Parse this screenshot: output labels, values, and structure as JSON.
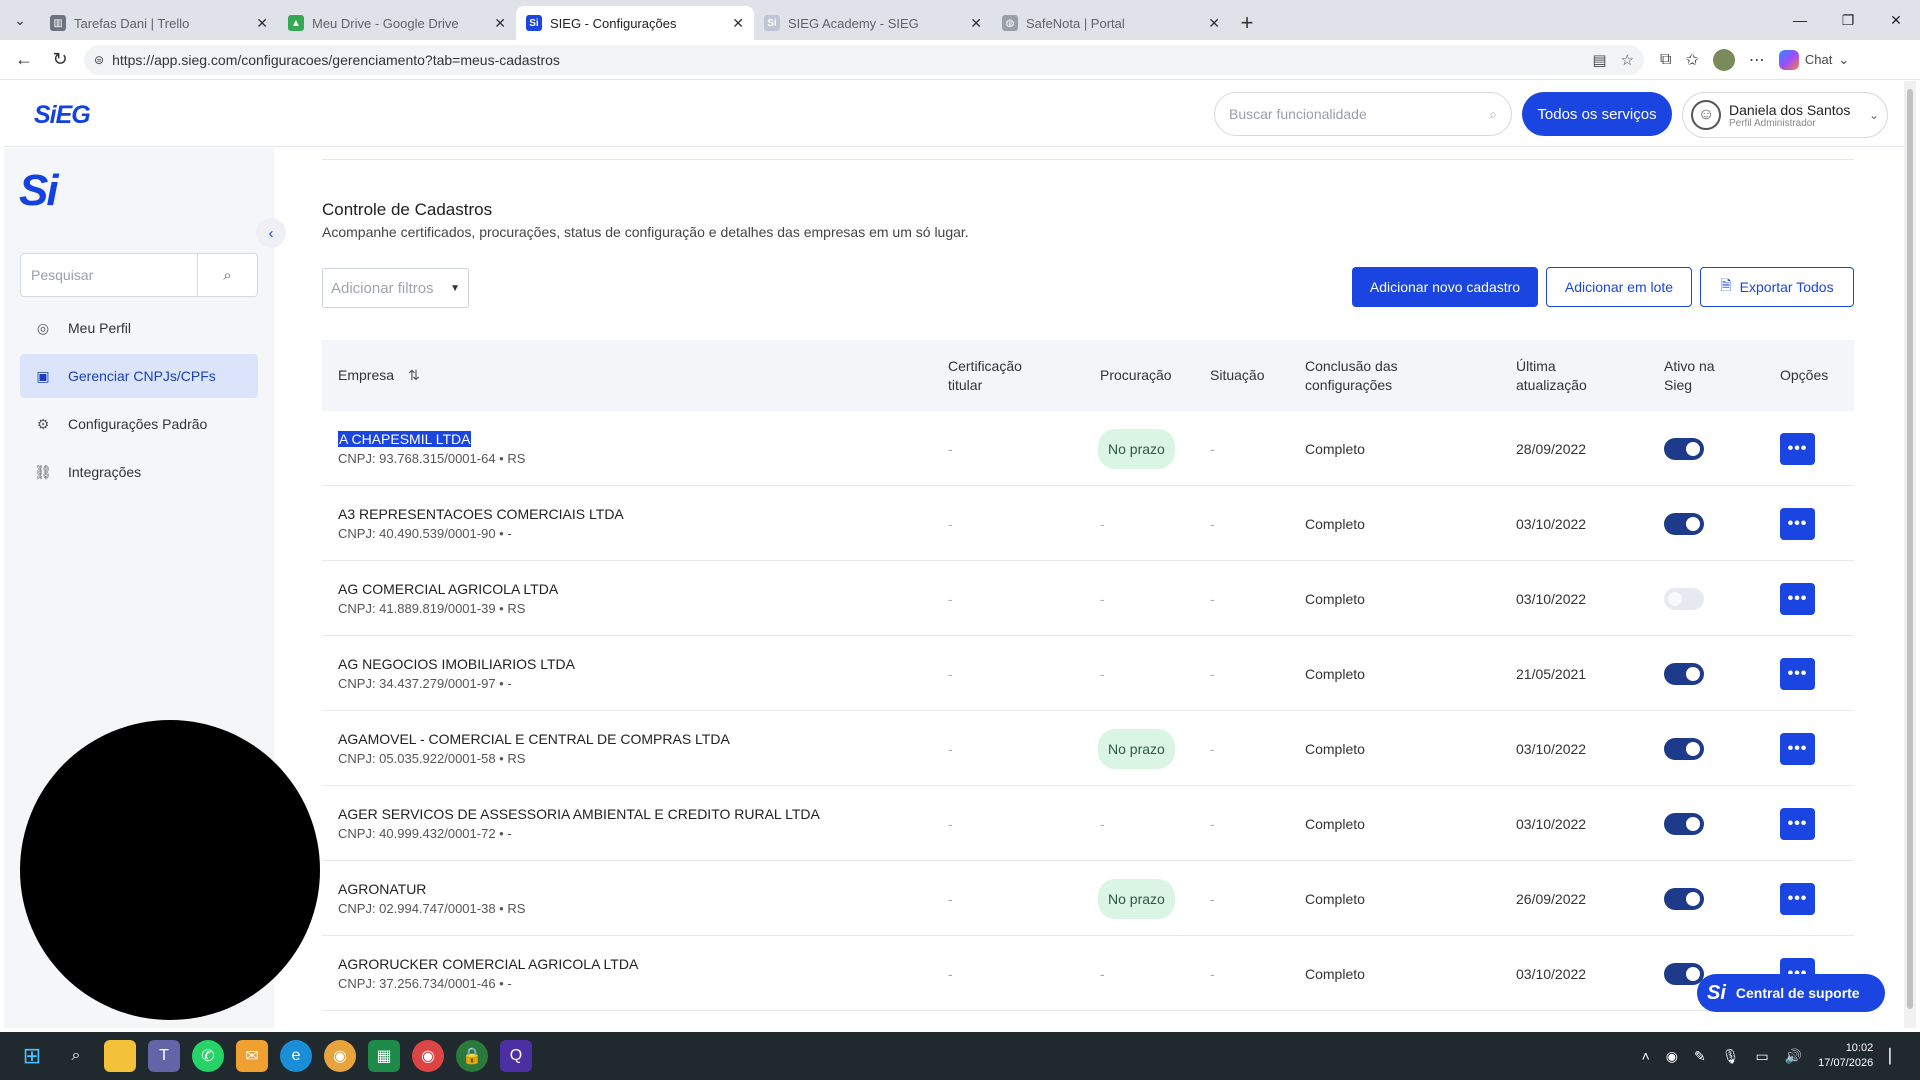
{
  "browser": {
    "tabs": [
      {
        "label": "Tarefas Dani | Trello",
        "color": "#6b7280",
        "glyph": "▥"
      },
      {
        "label": "Meu Drive - Google Drive",
        "color": "#34a853",
        "glyph": "▲"
      },
      {
        "label": "SIEG - Configurações",
        "color": "#1a45e0",
        "glyph": "Si"
      },
      {
        "label": "SIEG Academy - SIEG",
        "color": "#bfc5d2",
        "glyph": "Si"
      },
      {
        "label": "SafeNota | Portal",
        "color": "#9aa0a6",
        "glyph": "◍"
      }
    ],
    "url": "https://app.sieg.com/configuracoes/gerenciamento?tab=meus-cadastros",
    "chat_label": "Chat"
  },
  "header": {
    "brand": "SiEG",
    "search_placeholder": "Buscar funcionalidade",
    "services_button": "Todos os serviços",
    "user_name": "Daniela dos Santos",
    "user_role": "Perfil Administrador"
  },
  "sidebar": {
    "logo": "Si",
    "search_placeholder": "Pesquisar",
    "items": [
      {
        "label": "Meu Perfil",
        "icon": "◎"
      },
      {
        "label": "Gerenciar CNPJs/CPFs",
        "icon": "▣"
      },
      {
        "label": "Configurações Padrão",
        "icon": "⚙"
      },
      {
        "label": "Integrações",
        "icon": "⛓"
      }
    ]
  },
  "main": {
    "title": "Controle de Cadastros",
    "subtitle": "Acompanhe certificados, procurações, status de configuração e detalhes das empresas em um só lugar.",
    "filters_placeholder": "Adicionar filtros",
    "btn_new": "Adicionar novo cadastro",
    "btn_lote": "Adicionar em lote",
    "btn_export": "Exportar Todos",
    "columns": {
      "empresa": "Empresa",
      "cert": [
        "Certificação",
        "titular"
      ],
      "procuracao": "Procuração",
      "situacao": "Situação",
      "conclusao": [
        "Conclusão das",
        "configurações"
      ],
      "ultima": [
        "Última",
        "atualização"
      ],
      "ativo": [
        "Ativo na",
        "Sieg"
      ],
      "opcoes": "Opções"
    },
    "rows": [
      {
        "name": "A CHAPESMIL LTDA",
        "cnpj": "CNPJ: 93.768.315/0001-64 • RS",
        "cert": "-",
        "procuracao": "No prazo",
        "situacao": "-",
        "conclusao": "Completo",
        "ultima": "28/09/2022",
        "ativo": true,
        "selected": true
      },
      {
        "name": "A3 REPRESENTACOES COMERCIAIS LTDA",
        "cnpj": "CNPJ: 40.490.539/0001-90 • -",
        "cert": "-",
        "procuracao": "-",
        "situacao": "-",
        "conclusao": "Completo",
        "ultima": "03/10/2022",
        "ativo": true,
        "selected": false
      },
      {
        "name": "AG COMERCIAL AGRICOLA LTDA",
        "cnpj": "CNPJ: 41.889.819/0001-39 • RS",
        "cert": "-",
        "procuracao": "-",
        "situacao": "-",
        "conclusao": "Completo",
        "ultima": "03/10/2022",
        "ativo": false,
        "selected": false
      },
      {
        "name": "AG NEGOCIOS IMOBILIARIOS LTDA",
        "cnpj": "CNPJ: 34.437.279/0001-97 • -",
        "cert": "-",
        "procuracao": "-",
        "situacao": "-",
        "conclusao": "Completo",
        "ultima": "21/05/2021",
        "ativo": true,
        "selected": false
      },
      {
        "name": "AGAMOVEL - COMERCIAL E CENTRAL DE COMPRAS LTDA",
        "cnpj": "CNPJ: 05.035.922/0001-58 • RS",
        "cert": "-",
        "procuracao": "No prazo",
        "situacao": "-",
        "conclusao": "Completo",
        "ultima": "03/10/2022",
        "ativo": true,
        "selected": false
      },
      {
        "name": "AGER SERVICOS DE ASSESSORIA AMBIENTAL E CREDITO RURAL LTDA",
        "cnpj": "CNPJ: 40.999.432/0001-72 • -",
        "cert": "-",
        "procuracao": "-",
        "situacao": "-",
        "conclusao": "Completo",
        "ultima": "03/10/2022",
        "ativo": true,
        "selected": false
      },
      {
        "name": "AGRONATUR",
        "cnpj": "CNPJ: 02.994.747/0001-38 • RS",
        "cert": "-",
        "procuracao": "No prazo",
        "situacao": "-",
        "conclusao": "Completo",
        "ultima": "26/09/2022",
        "ativo": true,
        "selected": false
      },
      {
        "name": "AGRORUCKER COMERCIAL AGRICOLA LTDA",
        "cnpj": "CNPJ: 37.256.734/0001-46 • -",
        "cert": "-",
        "procuracao": "-",
        "situacao": "-",
        "conclusao": "Completo",
        "ultima": "03/10/2022",
        "ativo": true,
        "selected": false
      }
    ]
  },
  "support": {
    "logo": "Si",
    "label": "Central de suporte"
  },
  "taskbar": {
    "time": "10:02",
    "date": "17/07/2026"
  }
}
